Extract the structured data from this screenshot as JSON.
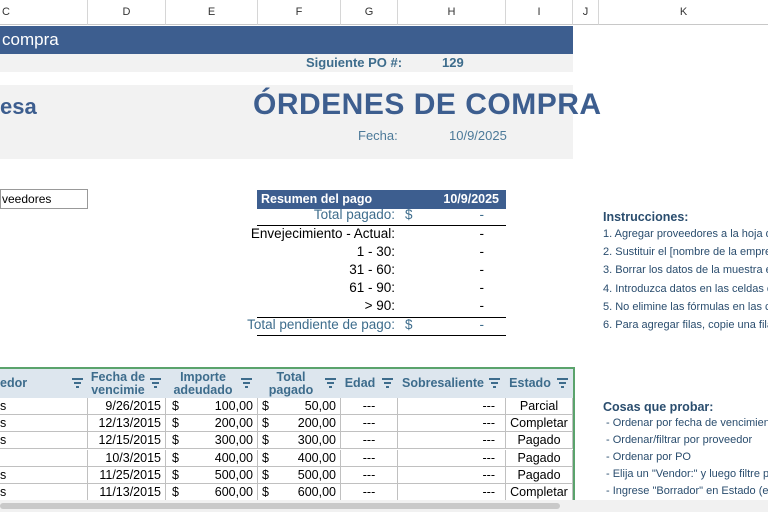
{
  "columns": [
    "C",
    "D",
    "E",
    "F",
    "G",
    "H",
    "I",
    "J",
    "K"
  ],
  "banner": {
    "title": "compra"
  },
  "po": {
    "label": "Siguiente PO #:",
    "value": "129"
  },
  "hero": {
    "company": "esa",
    "title": "ÓRDENES DE COMPRA",
    "date_label": "Fecha:",
    "date_value": "10/9/2025"
  },
  "filter": {
    "value": "veedores"
  },
  "summary": {
    "header_label": "Resumen del pago",
    "header_date": "10/9/2025",
    "rows": [
      {
        "label": "Total pagado:",
        "currency": "$",
        "value": "-"
      },
      {
        "label": "Envejecimiento - Actual:",
        "currency": "",
        "value": "-"
      },
      {
        "label": "1 - 30:",
        "currency": "",
        "value": "-"
      },
      {
        "label": "31 - 60:",
        "currency": "",
        "value": "-"
      },
      {
        "label": "61 - 90:",
        "currency": "",
        "value": "-"
      },
      {
        "label": "> 90:",
        "currency": "",
        "value": "-"
      },
      {
        "label": "Total pendiente de pago:",
        "currency": "$",
        "value": "-"
      }
    ]
  },
  "instructions": {
    "title": "Instrucciones:",
    "items": [
      "1. Agregar proveedores a la hoja d",
      "2. Sustituir el [nombre de la empre",
      "3. Borrar los datos de la muestra e",
      "4. Introduzca datos en las celdas c",
      "5. No elimine las fórmulas en las c",
      "6. Para agregar filas, copie una fila"
    ]
  },
  "try_things": {
    "title": "Cosas que probar:",
    "items": [
      "- Ordenar por fecha de vencimient",
      "- Ordenar/filtrar por proveedor",
      "- Ordenar por PO",
      "- Elija un \"Vendor:\" y luego filtre p",
      "- Ingrese \"Borrador\" en Estado (e"
    ]
  },
  "table": {
    "headers": {
      "vendor": "edor",
      "due_date": "Fecha de vencimie",
      "amount_due": "Importe adeudado",
      "total_paid": "Total pagado",
      "age": "Edad",
      "overdue": "Sobresaliente",
      "status": "Estado"
    },
    "rows": [
      {
        "vendor": "s",
        "due": "9/26/2015",
        "cur1": "$",
        "amount": "100,00",
        "cur2": "$",
        "paid": "50,00",
        "age": "---",
        "overdue": "---",
        "status": "Parcial"
      },
      {
        "vendor": "s",
        "due": "12/13/2015",
        "cur1": "$",
        "amount": "200,00",
        "cur2": "$",
        "paid": "200,00",
        "age": "---",
        "overdue": "---",
        "status": "Completar"
      },
      {
        "vendor": "s",
        "due": "12/15/2015",
        "cur1": "$",
        "amount": "300,00",
        "cur2": "$",
        "paid": "300,00",
        "age": "---",
        "overdue": "---",
        "status": "Pagado"
      },
      {
        "vendor": "",
        "due": "10/3/2015",
        "cur1": "$",
        "amount": "400,00",
        "cur2": "$",
        "paid": "400,00",
        "age": "---",
        "overdue": "---",
        "status": "Pagado"
      },
      {
        "vendor": "s",
        "due": "11/25/2015",
        "cur1": "$",
        "amount": "500,00",
        "cur2": "$",
        "paid": "500,00",
        "age": "---",
        "overdue": "---",
        "status": "Pagado"
      },
      {
        "vendor": "s",
        "due": "11/13/2015",
        "cur1": "$",
        "amount": "600,00",
        "cur2": "$",
        "paid": "600,00",
        "age": "---",
        "overdue": "---",
        "status": "Completar"
      }
    ]
  }
}
